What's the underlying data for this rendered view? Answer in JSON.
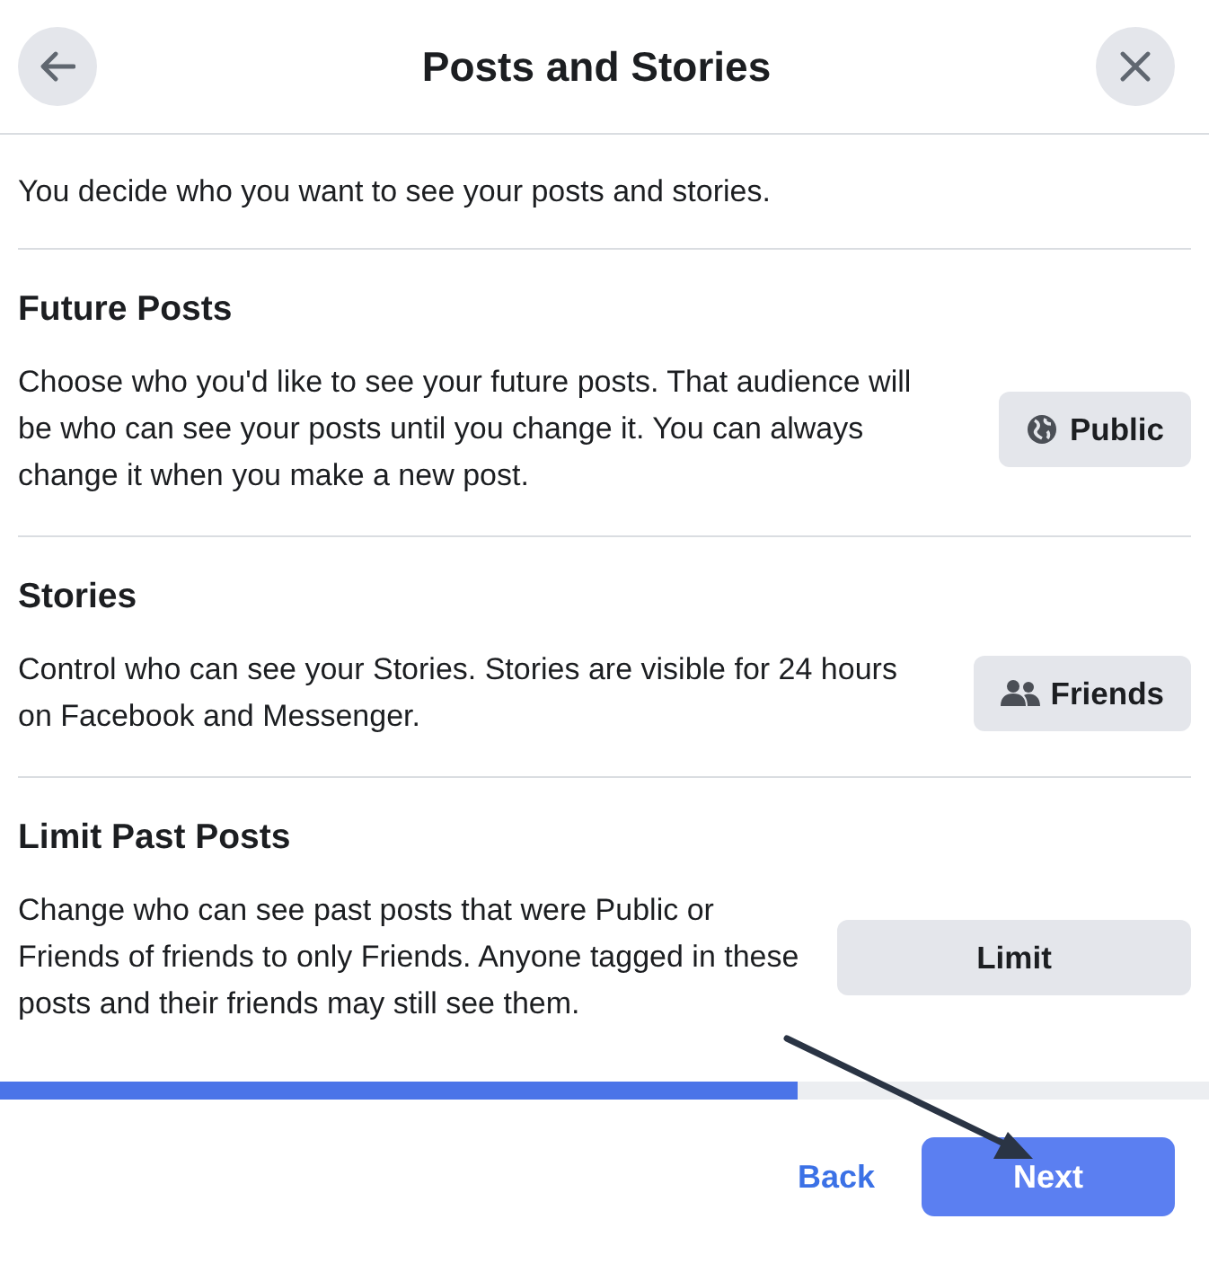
{
  "header": {
    "title": "Posts and Stories"
  },
  "intro": "You decide who you want to see your posts and stories.",
  "sections": [
    {
      "heading": "Future Posts",
      "text": "Choose who you'd like to see your future posts. That audience will be who can see your posts until you change it. You can always change it when you make a new post.",
      "button": {
        "label": "Public",
        "kind": "public"
      }
    },
    {
      "heading": "Stories",
      "text": "Control who can see your Stories. Stories are visible for 24 hours on Facebook and Messenger.",
      "button": {
        "label": "Friends",
        "kind": "friends"
      }
    },
    {
      "heading": "Limit Past Posts",
      "text": "Change who can see past posts that were Public or Friends of friends to only Friends. Anyone tagged in these posts and their friends may still see them.",
      "button": {
        "label": "Limit",
        "kind": "plain"
      }
    }
  ],
  "progress": {
    "level": 0.66
  },
  "footer": {
    "back": "Back",
    "next": "Next"
  }
}
